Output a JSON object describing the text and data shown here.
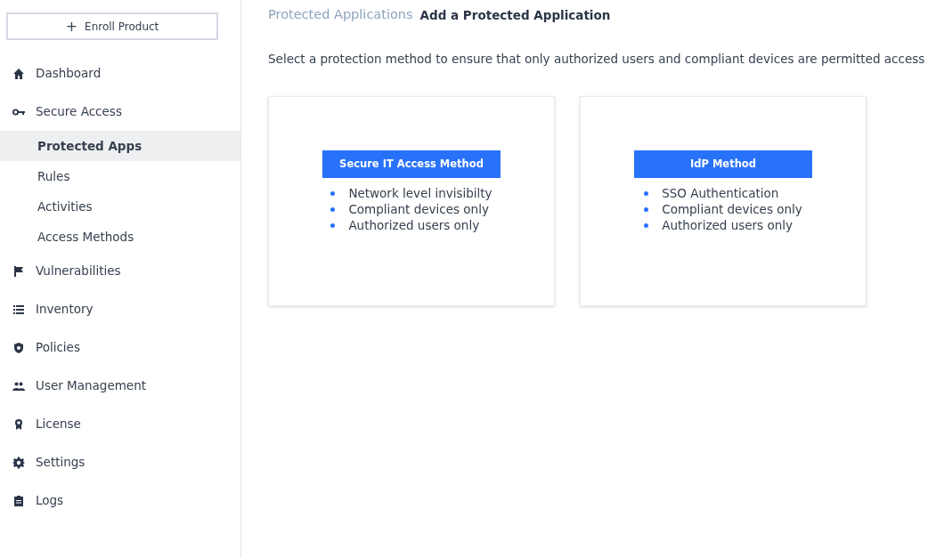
{
  "enroll_button": {
    "label": "Enroll Product",
    "icon": "+"
  },
  "sidebar": {
    "items": [
      {
        "label": "Dashboard",
        "selected": false
      },
      {
        "label": "Secure Access",
        "selected": false,
        "children": [
          {
            "label": "Protected Apps",
            "selected": true
          },
          {
            "label": "Rules",
            "selected": false
          },
          {
            "label": "Activities",
            "selected": false
          },
          {
            "label": "Access Methods",
            "selected": false
          }
        ]
      },
      {
        "label": "Vulnerabilities",
        "selected": false
      },
      {
        "label": "Inventory",
        "selected": false
      },
      {
        "label": "Policies",
        "selected": false
      },
      {
        "label": "User Management",
        "selected": false
      },
      {
        "label": "License",
        "selected": false
      },
      {
        "label": "Settings",
        "selected": false
      },
      {
        "label": "Logs",
        "selected": false
      }
    ]
  },
  "breadcrumb": [
    "Protected Applications",
    "Add a Protected Application"
  ],
  "intro": "Select a protection method to ensure that only authorized users and compliant devices are permitted access",
  "methods": [
    {
      "button": "Secure IT Access Method",
      "features": [
        "Network level invisibilty",
        "Compliant devices only",
        "Authorized users only"
      ]
    },
    {
      "button": "IdP Method",
      "features": [
        "SSO Authentication",
        "Compliant devices only",
        "Authorized users only"
      ]
    }
  ]
}
